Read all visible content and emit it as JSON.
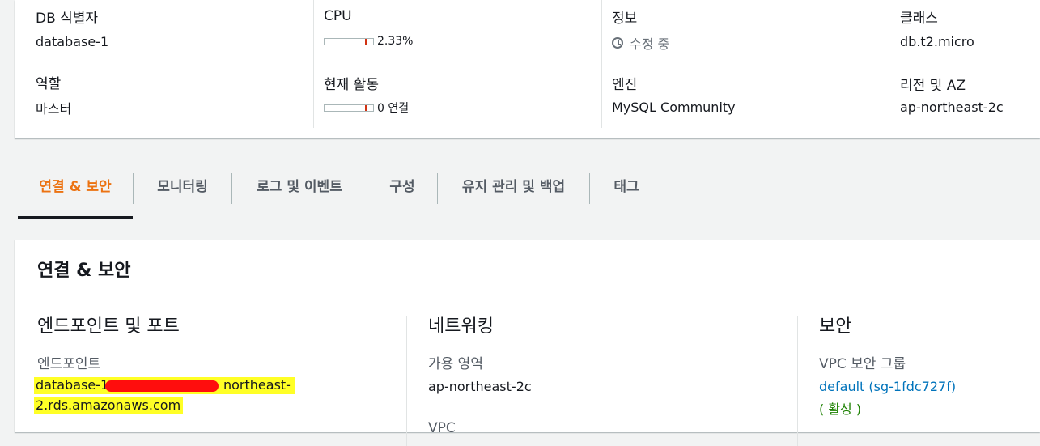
{
  "summary": {
    "db_identifier": {
      "label": "DB 식별자",
      "value": "database-1"
    },
    "cpu": {
      "label": "CPU",
      "value": "2.33%",
      "level_percent": 2.33
    },
    "info": {
      "label": "정보",
      "value": "수정 중"
    },
    "class": {
      "label": "클래스",
      "value": "db.t2.micro"
    },
    "role": {
      "label": "역할",
      "value": "마스터"
    },
    "current_activity": {
      "label": "현재 활동",
      "value": "0 연결"
    },
    "engine": {
      "label": "엔진",
      "value": "MySQL Community"
    },
    "region_az": {
      "label": "리전 및 AZ",
      "value": "ap-northeast-2c"
    }
  },
  "tabs": [
    {
      "label": "연결 & 보안",
      "active": true
    },
    {
      "label": "모니터링",
      "active": false
    },
    {
      "label": "로그 및 이벤트",
      "active": false
    },
    {
      "label": "구성",
      "active": false
    },
    {
      "label": "유지 관리 및 백업",
      "active": false
    },
    {
      "label": "태그",
      "active": false
    }
  ],
  "panel": {
    "title": "연결 & 보안",
    "endpoint_section": {
      "heading": "엔드포인트 및 포트",
      "endpoint_label": "엔드포인트",
      "endpoint_line1_start": "database-1",
      "endpoint_line1_end": "northeast-",
      "endpoint_line2": "2.rds.amazonaws.com"
    },
    "network_section": {
      "heading": "네트워킹",
      "az_label": "가용 영역",
      "az_value": "ap-northeast-2c",
      "vpc_label": "VPC"
    },
    "security_section": {
      "heading": "보안",
      "vpc_sg_label": "VPC 보안 그룹",
      "sg_link": "default (sg-1fdc727f)",
      "sg_status": "( 활성 )"
    }
  },
  "colors": {
    "accent_tab": "#ec7211",
    "link": "#0073bb",
    "active_status": "#1d8102",
    "highlight": "#ffff26",
    "redaction": "#ff0d0d"
  }
}
